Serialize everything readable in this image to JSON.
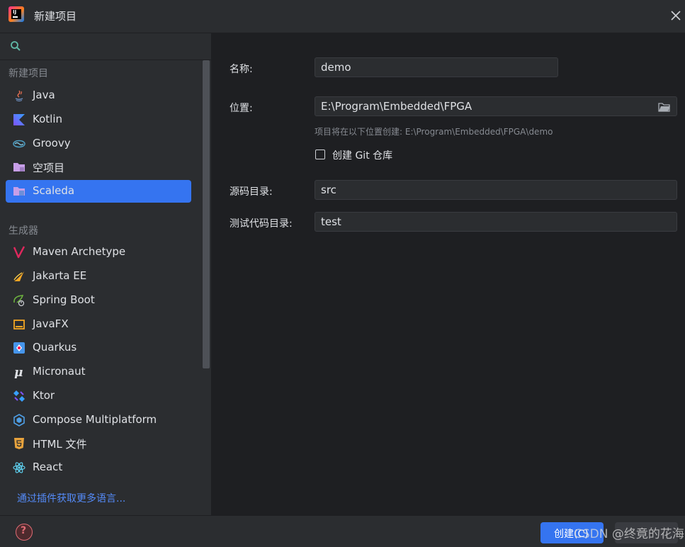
{
  "window": {
    "title": "新建项目",
    "close_icon": "close-icon"
  },
  "search": {
    "placeholder": "",
    "icon": "search-icon"
  },
  "sidebar": {
    "section_new": "新建项目",
    "new_items": [
      {
        "label": "Java",
        "icon": "java-icon"
      },
      {
        "label": "Kotlin",
        "icon": "kotlin-icon"
      },
      {
        "label": "Groovy",
        "icon": "groovy-icon"
      },
      {
        "label": "空项目",
        "icon": "empty-project-icon"
      },
      {
        "label": "Scaleda",
        "icon": "scaleda-icon",
        "selected": true
      }
    ],
    "section_generators": "生成器",
    "generator_items": [
      {
        "label": "Maven Archetype",
        "icon": "maven-icon"
      },
      {
        "label": "Jakarta EE",
        "icon": "jakarta-icon"
      },
      {
        "label": "Spring Boot",
        "icon": "spring-boot-icon"
      },
      {
        "label": "JavaFX",
        "icon": "javafx-icon"
      },
      {
        "label": "Quarkus",
        "icon": "quarkus-icon"
      },
      {
        "label": "Micronaut",
        "icon": "micronaut-icon"
      },
      {
        "label": "Ktor",
        "icon": "ktor-icon"
      },
      {
        "label": "Compose Multiplatform",
        "icon": "compose-icon"
      },
      {
        "label": "HTML 文件",
        "icon": "html-icon"
      },
      {
        "label": "React",
        "icon": "react-icon"
      }
    ],
    "more_link": "通过插件获取更多语言..."
  },
  "form": {
    "name_label": "名称:",
    "name_value": "demo",
    "location_label": "位置:",
    "location_value": "E:\\Program\\Embedded\\FPGA",
    "location_hint": "项目将在以下位置创建: E:\\Program\\Embedded\\FPGA\\demo",
    "git_label": "创建 Git 仓库",
    "git_checked": false,
    "source_label": "源码目录:",
    "source_value": "src",
    "test_label": "测试代码目录:",
    "test_value": "test"
  },
  "footer": {
    "help_glyph": "?",
    "create_label": "创建(C)",
    "watermark": "CSDN @终竟的花海"
  },
  "colors": {
    "accent": "#3574f0",
    "background": "#1e1f22",
    "panel": "#2b2d30",
    "link": "#548af7"
  }
}
